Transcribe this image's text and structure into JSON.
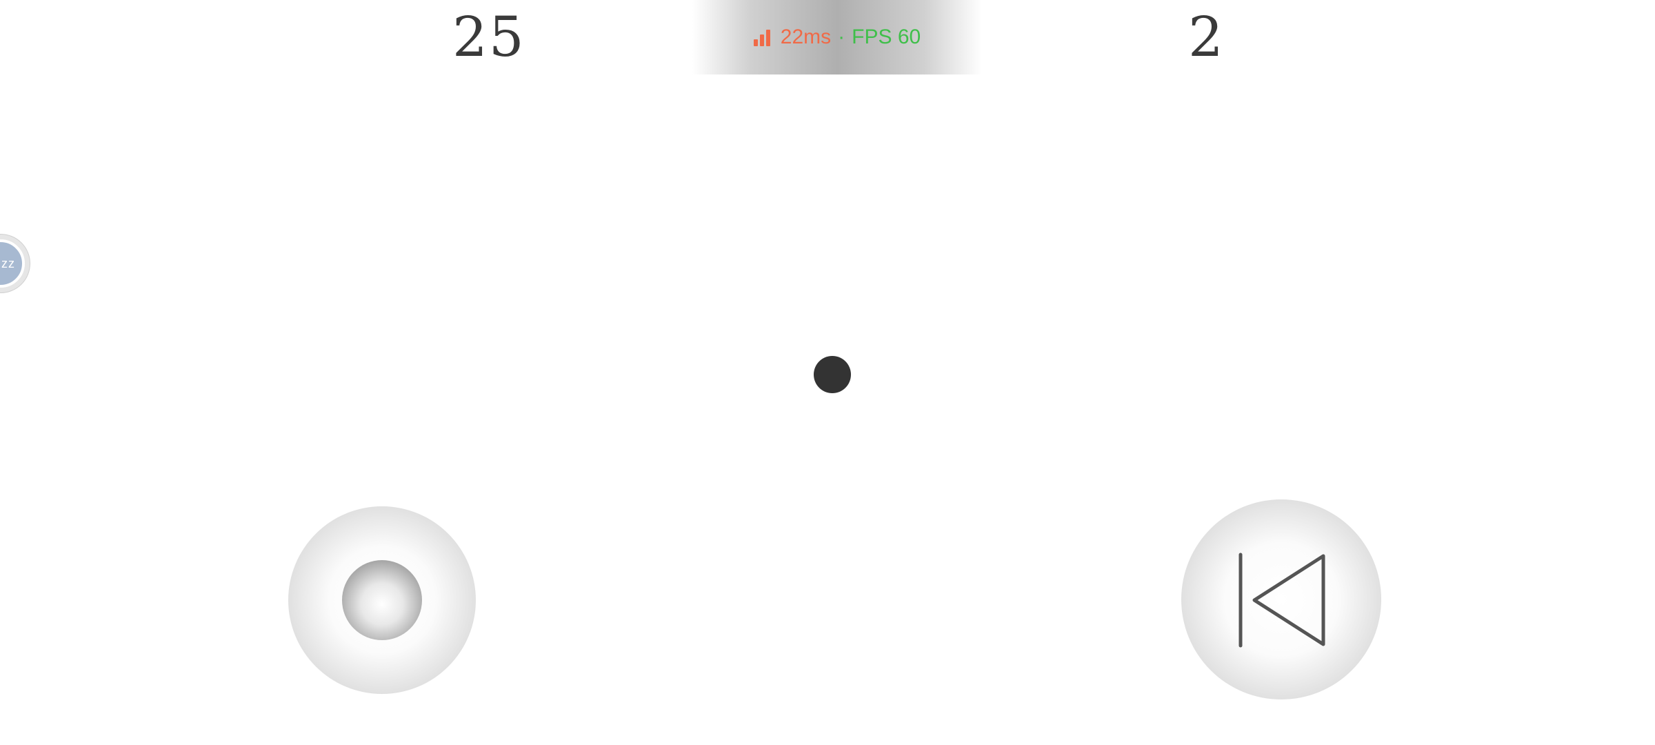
{
  "scoreboard": {
    "left_score": "25",
    "right_score": "2"
  },
  "performance": {
    "latency": "22ms",
    "separator": "·",
    "fps": "FPS 60",
    "latency_color": "#f06a47",
    "fps_color": "#3fbf4a",
    "signal_icon": "signal-bars-icon"
  },
  "side_bubble": {
    "label": "zz",
    "icon": "sleep-bubble-icon"
  },
  "controls": {
    "joystick_icon": "joystick-knob",
    "back_icon": "skip-back-icon"
  },
  "colors": {
    "ball": "#333333",
    "score": "#3a3a3a"
  }
}
